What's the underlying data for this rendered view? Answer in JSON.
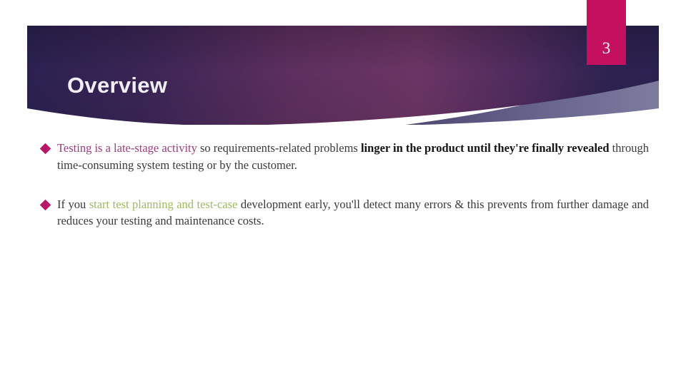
{
  "slide": {
    "title": "Overview",
    "page_number": "3",
    "accent_colors": {
      "banner_dark": "#2b2150",
      "banner_mid": "#6b3564",
      "page_tab_magenta": "#c4105f",
      "bullet_diamond": "#b8186a",
      "highlight_purple": "#9c3d7b",
      "highlight_green": "#9dbb61",
      "title_text": "#f2eef6",
      "body_text": "#3a3a3a",
      "swoosh_gray": "#6d6a8c"
    }
  },
  "bullets": [
    {
      "marker": "diamond-bullet",
      "segments": [
        {
          "text": "Testing is a late-stage activity ",
          "style": "purple"
        },
        {
          "text": "so requirements-related problems ",
          "style": "normal"
        },
        {
          "text": "linger in the product until they're finally revealed ",
          "style": "bold"
        },
        {
          "text": "through time-consuming system testing or by the customer.",
          "style": "normal"
        }
      ],
      "plain_text": "Testing is a late-stage activity so requirements-related problems linger in the product until they're finally revealed through time-consuming system testing or by the customer."
    },
    {
      "marker": "diamond-bullet",
      "segments": [
        {
          "text": "If you ",
          "style": "normal"
        },
        {
          "text": "start test planning and test-case ",
          "style": "green"
        },
        {
          "text": "development early, you'll detect many errors & this prevents from further damage and reduces your testing and maintenance costs.",
          "style": "normal"
        }
      ],
      "plain_text": "If you start test planning and test-case development early, you'll detect many errors & this prevents from further damage and reduces your testing and maintenance costs."
    }
  ]
}
